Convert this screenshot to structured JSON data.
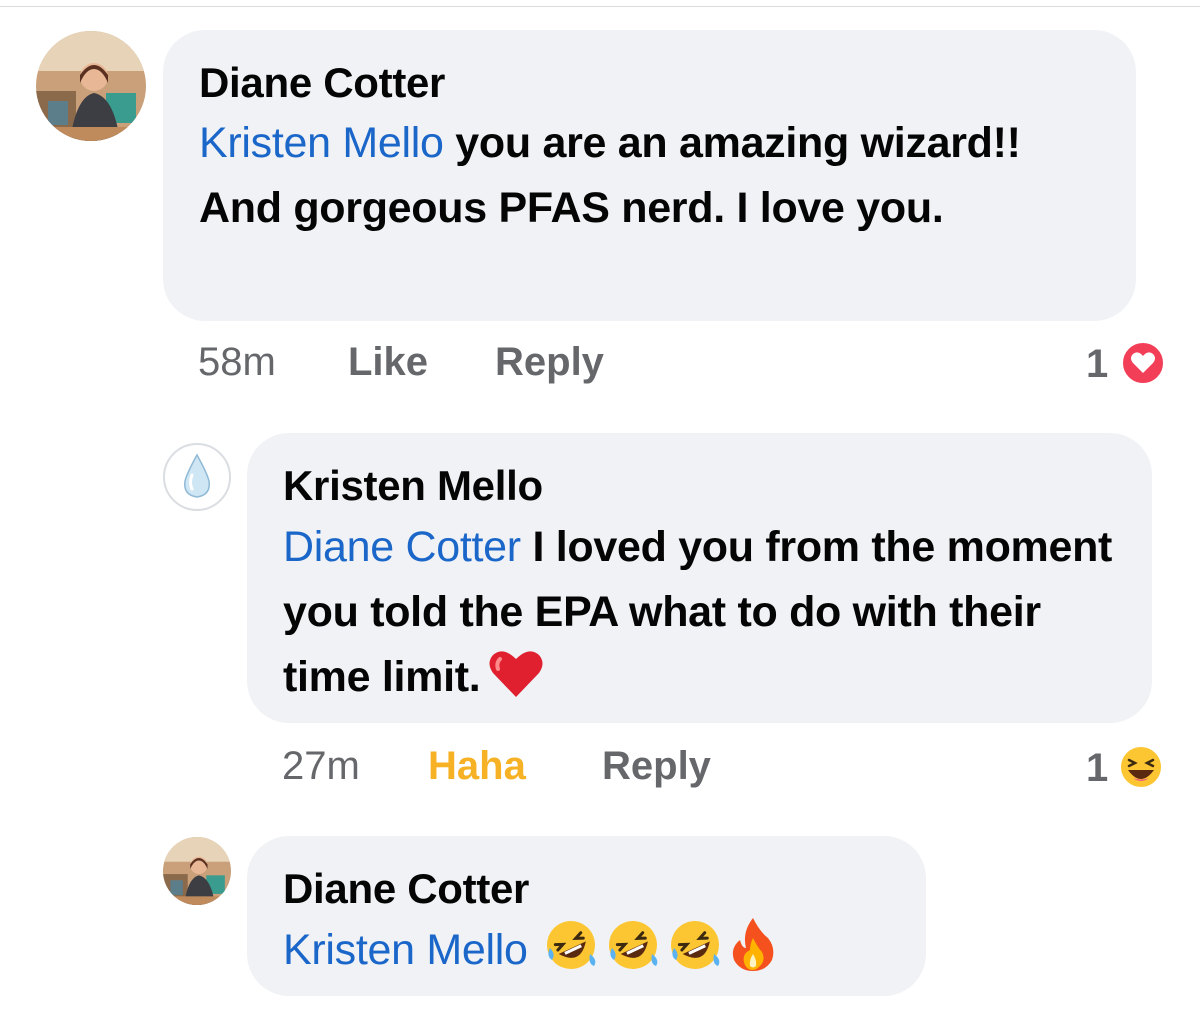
{
  "comments": [
    {
      "author": "Diane Cotter",
      "mention": "Kristen Mello",
      "text": " you are an amazing wizard!! And gorgeous PFAS nerd.  I love you.",
      "time": "58m",
      "action_like": "Like",
      "action_reply": "Reply",
      "reaction_count": "1",
      "reaction_icon": "heart-reaction-icon",
      "avatar": "profile-photo-diane"
    },
    {
      "author": "Kristen Mello",
      "mention": "Diane Cotter",
      "text": " I loved you from the moment you told the EPA what to do with their time limit.",
      "trailing_emoji": "red-heart-icon",
      "time": "27m",
      "action_like": "Haha",
      "action_reply": "Reply",
      "reaction_count": "1",
      "reaction_icon": "haha-reaction-icon",
      "avatar": "water-drop-avatar"
    },
    {
      "author": "Diane Cotter",
      "mention": "Kristen Mello",
      "trailing_emojis": [
        "rolling-laughing-icon",
        "rolling-laughing-icon",
        "rolling-laughing-icon",
        "fire-icon"
      ],
      "avatar": "profile-photo-diane"
    }
  ],
  "colors": {
    "bubble": "#f0f2f5",
    "mention": "#1a66c9",
    "meta": "#65676b",
    "haha": "#f7b125",
    "heart": "#f33e58"
  }
}
